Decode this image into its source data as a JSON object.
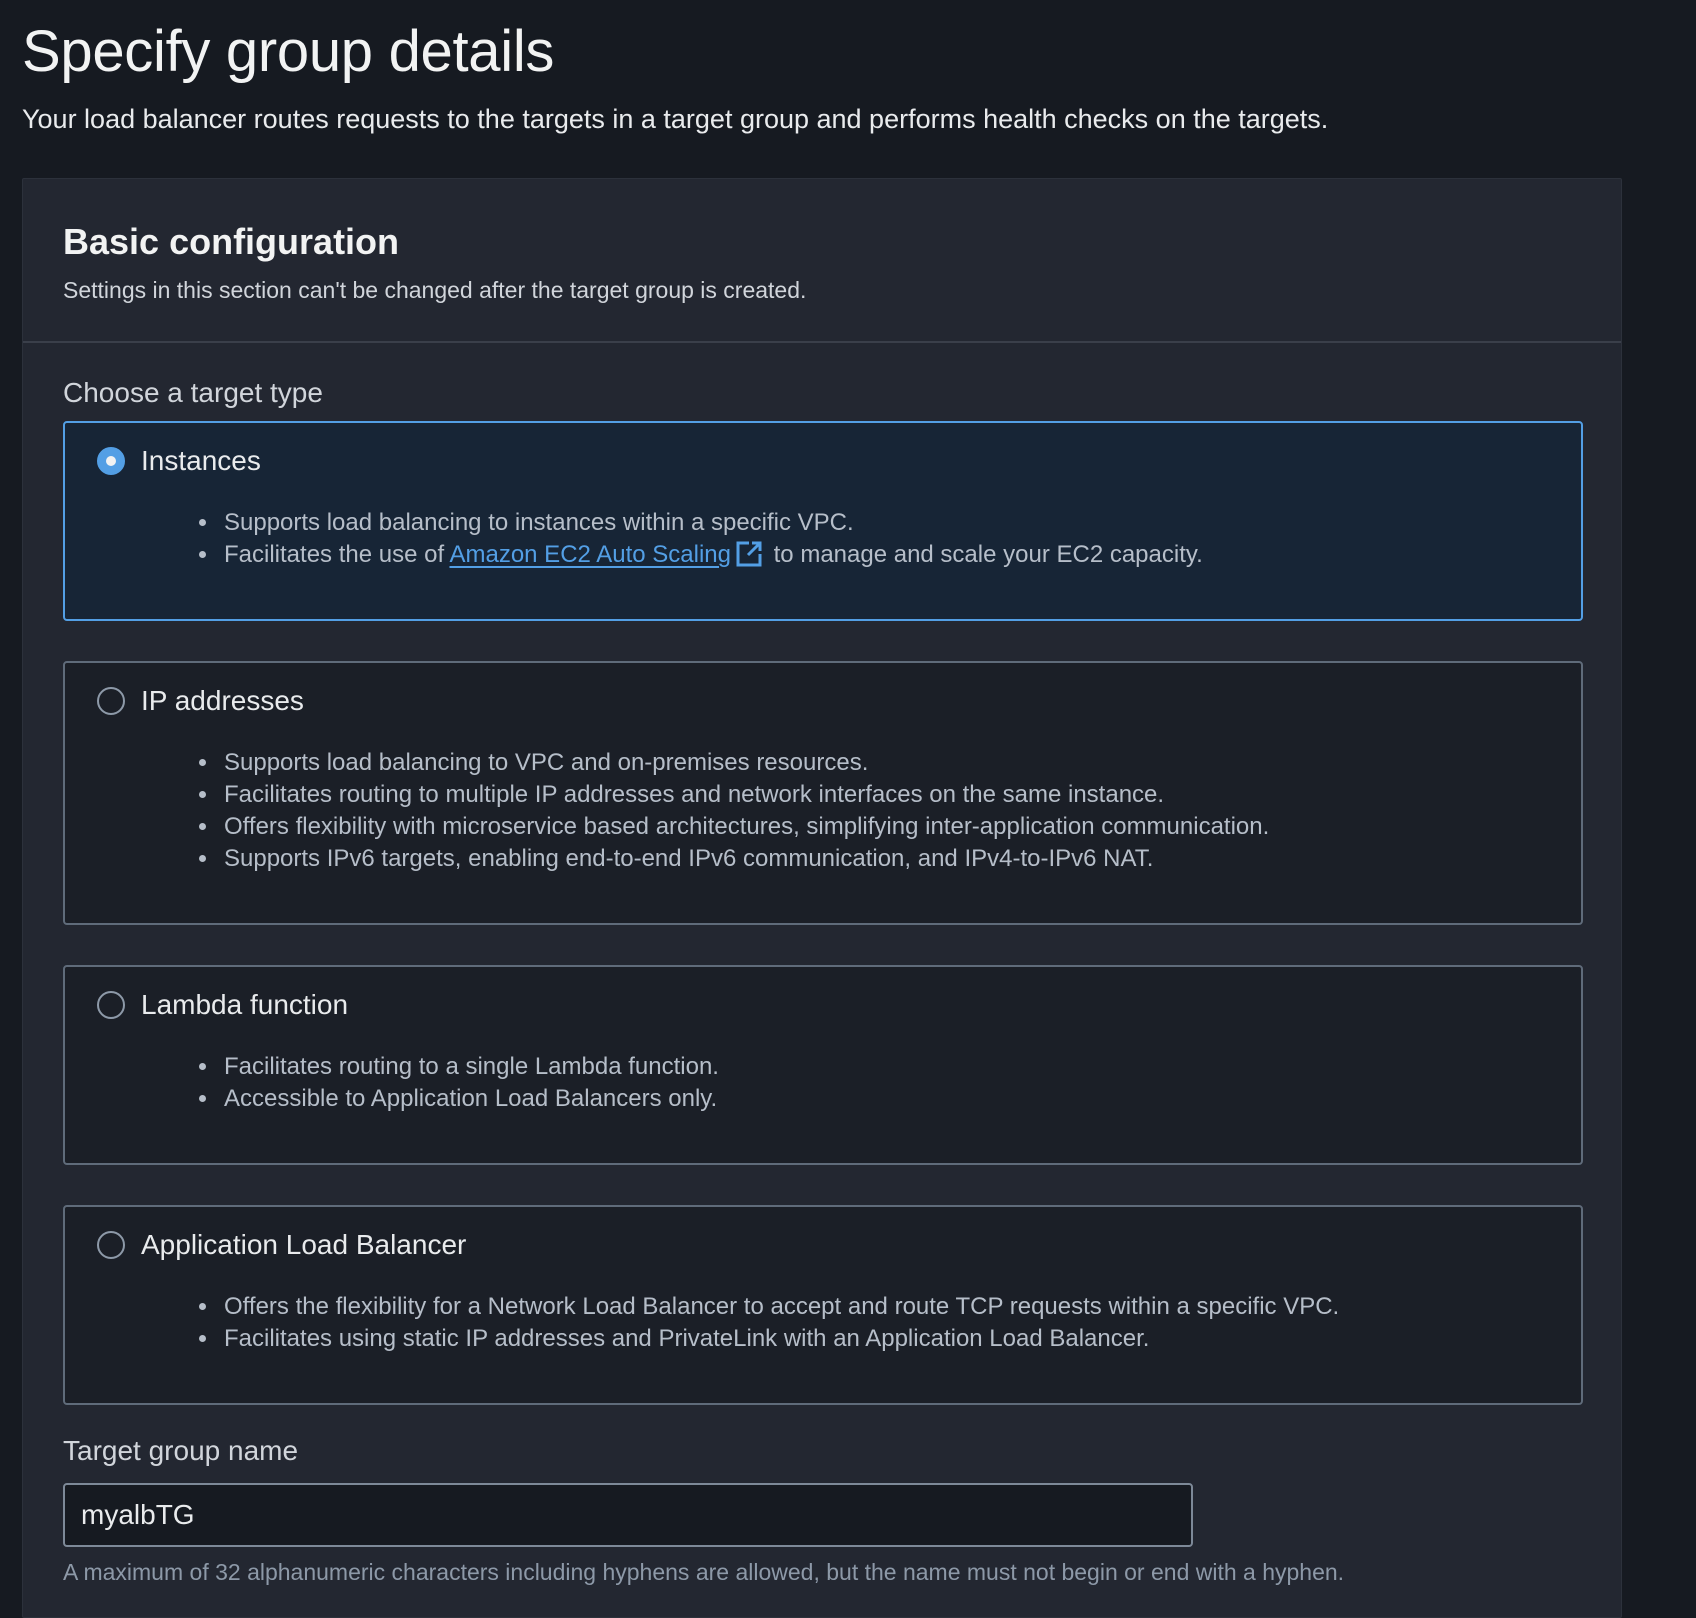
{
  "page": {
    "title": "Specify group details",
    "description": "Your load balancer routes requests to the targets in a target group and performs health checks on the targets."
  },
  "basic_config": {
    "title": "Basic configuration",
    "description": "Settings in this section can't be changed after the target group is created.",
    "target_type_label": "Choose a target type",
    "options": [
      {
        "title": "Instances",
        "selected": true,
        "bullets": [
          "Supports load balancing to instances within a specific VPC."
        ],
        "bullet2_prefix": "Facilitates the use of ",
        "bullet2_link": "Amazon EC2 Auto Scaling",
        "bullet2_suffix": " to manage and scale your EC2 capacity."
      },
      {
        "title": "IP addresses",
        "selected": false,
        "bullets": [
          "Supports load balancing to VPC and on-premises resources.",
          "Facilitates routing to multiple IP addresses and network interfaces on the same instance.",
          "Offers flexibility with microservice based architectures, simplifying inter-application communication.",
          "Supports IPv6 targets, enabling end-to-end IPv6 communication, and IPv4-to-IPv6 NAT."
        ]
      },
      {
        "title": "Lambda function",
        "selected": false,
        "bullets": [
          "Facilitates routing to a single Lambda function.",
          "Accessible to Application Load Balancers only."
        ]
      },
      {
        "title": "Application Load Balancer",
        "selected": false,
        "bullets": [
          "Offers the flexibility for a Network Load Balancer to accept and route TCP requests within a specific VPC.",
          "Facilitates using static IP addresses and PrivateLink with an Application Load Balancer."
        ]
      }
    ],
    "target_group_name": {
      "label": "Target group name",
      "value": "myalbTG",
      "hint": "A maximum of 32 alphanumeric characters including hyphens are allowed, but the name must not begin or end with a hyphen."
    }
  },
  "colors": {
    "accent": "#539fe5",
    "background": "#161a21",
    "panel": "#232731",
    "selected_tile": "#172536"
  },
  "icons": {
    "external_link": "external-link-icon"
  }
}
